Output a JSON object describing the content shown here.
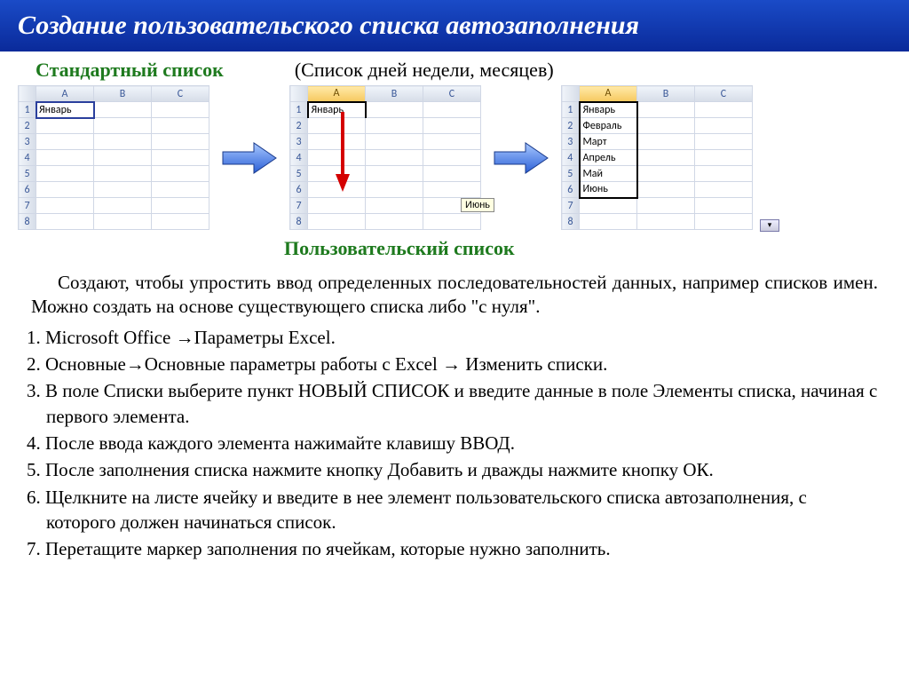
{
  "title": "Создание пользовательского списка автозаполнения",
  "heading_std": "Стандартный список",
  "heading_paren": "(Список дней недели, месяцев)",
  "heading_user": "Пользовательский  список",
  "grid1": {
    "colA": "A",
    "colB": "B",
    "colC": "C",
    "rows": [
      "1",
      "2",
      "3",
      "4",
      "5",
      "6",
      "7",
      "8"
    ],
    "a1": "Январь"
  },
  "grid2": {
    "colA": "A",
    "colB": "B",
    "colC": "C",
    "rows": [
      "1",
      "2",
      "3",
      "4",
      "5",
      "6",
      "7",
      "8"
    ],
    "a1": "Январь",
    "tooltip": "Июнь"
  },
  "grid3": {
    "colA": "A",
    "colB": "B",
    "colC": "C",
    "rows": [
      "1",
      "2",
      "3",
      "4",
      "5",
      "6",
      "7",
      "8"
    ],
    "cells": [
      "Январь",
      "Февраль",
      "Март",
      "Апрель",
      "Май",
      "Июнь"
    ]
  },
  "paragraph": "Создают, чтобы упростить ввод определенных последовательностей данных, например списков имен.  Можно создать на основе существующего списка либо \"с нуля\".",
  "steps": [
    "1. Microsoft Office →Параметры Excel.",
    "2. Основные→Основные параметры работы с Excel → Изменить списки.",
    "3. В поле Списки выберите пункт НОВЫЙ СПИСОК и введите данные в поле Элементы списка, начиная с первого элемента.",
    "4. После ввода каждого элемента нажимайте клавишу ВВОД.",
    "5. После заполнения списка нажмите кнопку Добавить и дважды нажмите кнопку ОК.",
    "6. Щелкните на листе ячейку и введите в нее элемент пользовательского списка автозаполнения, с которого должен начинаться список.",
    "7. Перетащите маркер заполнения по ячейкам, которые нужно заполнить."
  ]
}
